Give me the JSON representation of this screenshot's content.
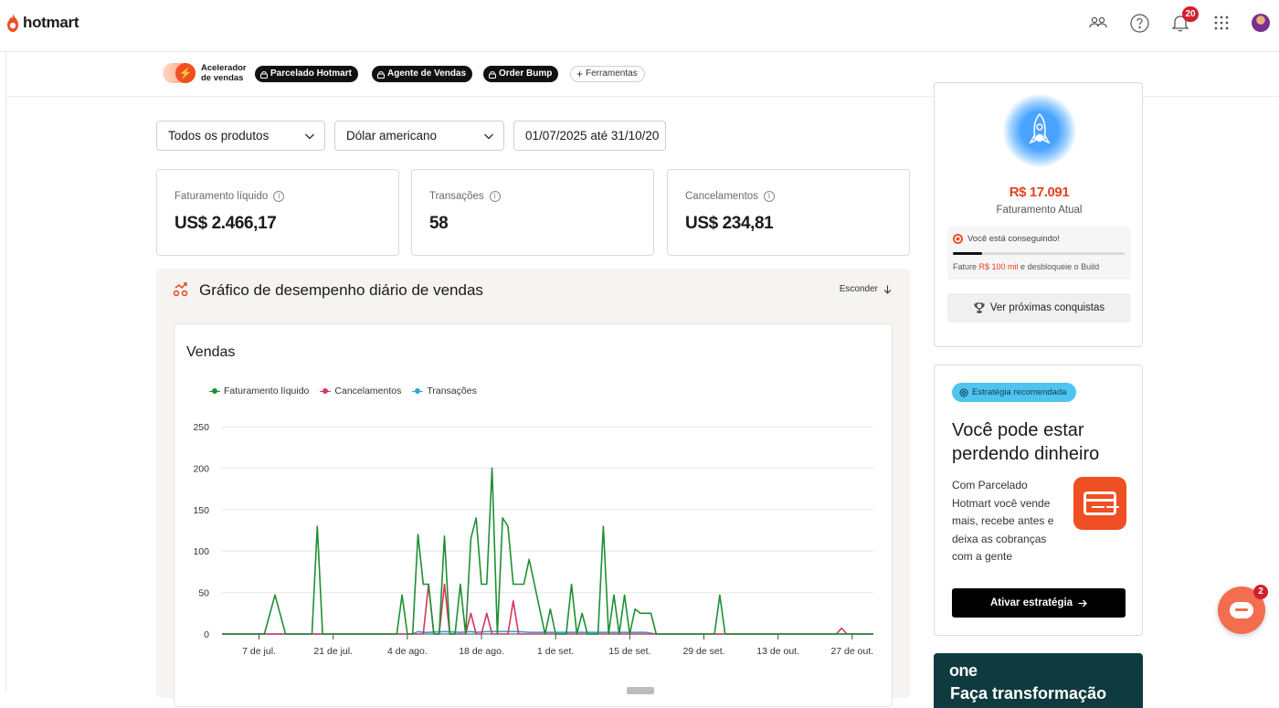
{
  "brand": {
    "name": "hotmart",
    "accent": "#f04e23"
  },
  "topbar": {
    "icons": [
      "team-icon",
      "help-icon",
      "bell-icon",
      "apps-grid-icon"
    ],
    "notifications_count": "20"
  },
  "subnav": {
    "accelerator_label": "Acelerador de vendas",
    "chips": [
      "Parcelado Hotmart",
      "Agente de Vendas",
      "Order Bump"
    ],
    "tools_label": "Ferramentas"
  },
  "filters": {
    "product": "Todos os produtos",
    "currency": "Dólar americano",
    "date_range": "01/07/2025 até 31/10/20"
  },
  "kpis": [
    {
      "label": "Faturamento líquido",
      "value": "US$ 2.466,17"
    },
    {
      "label": "Transações",
      "value": "58"
    },
    {
      "label": "Cancelamentos",
      "value": "US$ 234,81"
    }
  ],
  "performance": {
    "title": "Gráfico de desempenho diário de vendas",
    "hide_label": "Esconder",
    "chart_title": "Vendas"
  },
  "chart_data": {
    "type": "line",
    "ylim": [
      0,
      250
    ],
    "yticks": [
      0,
      50,
      100,
      150,
      200,
      250
    ],
    "xlim": [
      0,
      123
    ],
    "xtick_labels": [
      {
        "day": 7,
        "label": "7 de jul."
      },
      {
        "day": 21,
        "label": "21 de jul."
      },
      {
        "day": 35,
        "label": "4 de ago."
      },
      {
        "day": 49,
        "label": "18 de ago."
      },
      {
        "day": 63,
        "label": "1 de set."
      },
      {
        "day": 77,
        "label": "15 de set."
      },
      {
        "day": 91,
        "label": "29 de set."
      },
      {
        "day": 105,
        "label": "13 de out."
      },
      {
        "day": 119,
        "label": "27 de out."
      }
    ],
    "grid": true,
    "legend_position": "top-left",
    "series": [
      {
        "name": "Faturamento líquido",
        "color": "#1e8f33",
        "points": [
          [
            0,
            0
          ],
          [
            8,
            0
          ],
          [
            10,
            47
          ],
          [
            12,
            0
          ],
          [
            17,
            0
          ],
          [
            18,
            130
          ],
          [
            19,
            0
          ],
          [
            33,
            0
          ],
          [
            34,
            47
          ],
          [
            35,
            0
          ],
          [
            36,
            0
          ],
          [
            37,
            120
          ],
          [
            38,
            60
          ],
          [
            39,
            60
          ],
          [
            40,
            0
          ],
          [
            41,
            0
          ],
          [
            42,
            118
          ],
          [
            43,
            0
          ],
          [
            44,
            0
          ],
          [
            45,
            60
          ],
          [
            46,
            0
          ],
          [
            47,
            115
          ],
          [
            48,
            140
          ],
          [
            49,
            60
          ],
          [
            50,
            60
          ],
          [
            51,
            200
          ],
          [
            52,
            0
          ],
          [
            53,
            140
          ],
          [
            54,
            130
          ],
          [
            55,
            60
          ],
          [
            56,
            60
          ],
          [
            57,
            60
          ],
          [
            58,
            90
          ],
          [
            59,
            60
          ],
          [
            60,
            30
          ],
          [
            61,
            0
          ],
          [
            62,
            30
          ],
          [
            63,
            0
          ],
          [
            64,
            0
          ],
          [
            65,
            0
          ],
          [
            66,
            60
          ],
          [
            67,
            0
          ],
          [
            68,
            25
          ],
          [
            69,
            0
          ],
          [
            70,
            0
          ],
          [
            71,
            0
          ],
          [
            72,
            130
          ],
          [
            73,
            0
          ],
          [
            74,
            47
          ],
          [
            75,
            0
          ],
          [
            76,
            47
          ],
          [
            77,
            0
          ],
          [
            78,
            30
          ],
          [
            79,
            25
          ],
          [
            80,
            25
          ],
          [
            81,
            25
          ],
          [
            82,
            0
          ],
          [
            93,
            0
          ],
          [
            94,
            47
          ],
          [
            95,
            0
          ],
          [
            123,
            0
          ]
        ]
      },
      {
        "name": "Cancelamentos",
        "color": "#d6375a",
        "points": [
          [
            0,
            0
          ],
          [
            38,
            0
          ],
          [
            39,
            60
          ],
          [
            40,
            0
          ],
          [
            41,
            0
          ],
          [
            42,
            60
          ],
          [
            43,
            0
          ],
          [
            46,
            0
          ],
          [
            47,
            25
          ],
          [
            48,
            0
          ],
          [
            49,
            0
          ],
          [
            50,
            25
          ],
          [
            51,
            0
          ],
          [
            54,
            0
          ],
          [
            55,
            40
          ],
          [
            56,
            0
          ],
          [
            58,
            0
          ],
          [
            59,
            0
          ],
          [
            116,
            0
          ],
          [
            117,
            7
          ],
          [
            118,
            0
          ],
          [
            123,
            0
          ]
        ]
      },
      {
        "name": "Transações",
        "color": "#36a3d9",
        "points": [
          [
            0,
            0
          ],
          [
            36,
            0
          ],
          [
            37,
            3
          ],
          [
            38,
            2
          ],
          [
            39,
            2
          ],
          [
            42,
            3
          ],
          [
            45,
            2
          ],
          [
            47,
            3
          ],
          [
            48,
            2
          ],
          [
            50,
            3
          ],
          [
            51,
            3
          ],
          [
            53,
            3
          ],
          [
            54,
            3
          ],
          [
            55,
            3
          ],
          [
            56,
            3
          ],
          [
            58,
            2
          ],
          [
            66,
            2
          ],
          [
            72,
            2
          ],
          [
            74,
            2
          ],
          [
            76,
            2
          ],
          [
            78,
            2
          ],
          [
            80,
            2
          ],
          [
            82,
            0
          ],
          [
            94,
            0
          ],
          [
            123,
            0
          ]
        ]
      }
    ]
  },
  "goal": {
    "value": "R$ 17.091",
    "label": "Faturamento Atual",
    "progress_title": "Você está conseguindo!",
    "progress_fraction": 0.17,
    "note_pre": "Fature ",
    "note_highlight": "R$ 100 mil",
    "note_post": " e desbloqueie o Build",
    "next_button": "Ver próximas conquistas"
  },
  "strategy": {
    "tag": "Estratégia recomendada",
    "title": "Você pode estar perdendo dinheiro",
    "text": "Com Parcelado Hotmart você vende mais, recebe antes e deixa as cobranças com a gente",
    "button": "Ativar estratégia"
  },
  "promo": {
    "logo": "one",
    "subtitle": "Faça transformação"
  },
  "chat": {
    "badge": "2"
  }
}
